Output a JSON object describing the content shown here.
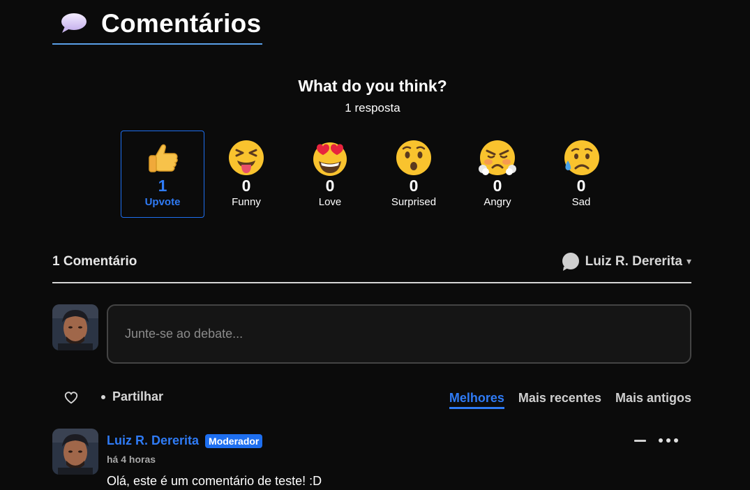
{
  "header": {
    "title": "Comentários",
    "icon": "speech-bubble-icon"
  },
  "reactions": {
    "title": "What do you think?",
    "responses": "1 resposta",
    "items": [
      {
        "emoji": "thumbs-up-icon",
        "count": "1",
        "label": "Upvote",
        "active": true
      },
      {
        "emoji": "squinting-tongue-face-icon",
        "count": "0",
        "label": "Funny"
      },
      {
        "emoji": "heart-eyes-face-icon",
        "count": "0",
        "label": "Love"
      },
      {
        "emoji": "surprised-face-icon",
        "count": "0",
        "label": "Surprised"
      },
      {
        "emoji": "angry-steam-face-icon",
        "count": "0",
        "label": "Angry"
      },
      {
        "emoji": "sad-sweat-face-icon",
        "count": "0",
        "label": "Sad"
      }
    ]
  },
  "comments_bar": {
    "count_label": "1 Comentário",
    "user_name": "Luiz R. Dererita",
    "caret": "▾"
  },
  "compose": {
    "placeholder": "Junte-se ao debate..."
  },
  "actions": {
    "share_label": "Partilhar",
    "sort_tabs": [
      "Melhores",
      "Mais recentes",
      "Mais antigos"
    ],
    "active_tab": "Melhores"
  },
  "comment": {
    "author": "Luiz R. Dererita",
    "badge": "Moderador",
    "time": "há 4 horas",
    "text": "Olá, este é um comentário de teste! :D"
  },
  "colors": {
    "background": "#0b0b0b",
    "accent": "#2f7bf5",
    "header_underline": "#5aa0e8"
  }
}
